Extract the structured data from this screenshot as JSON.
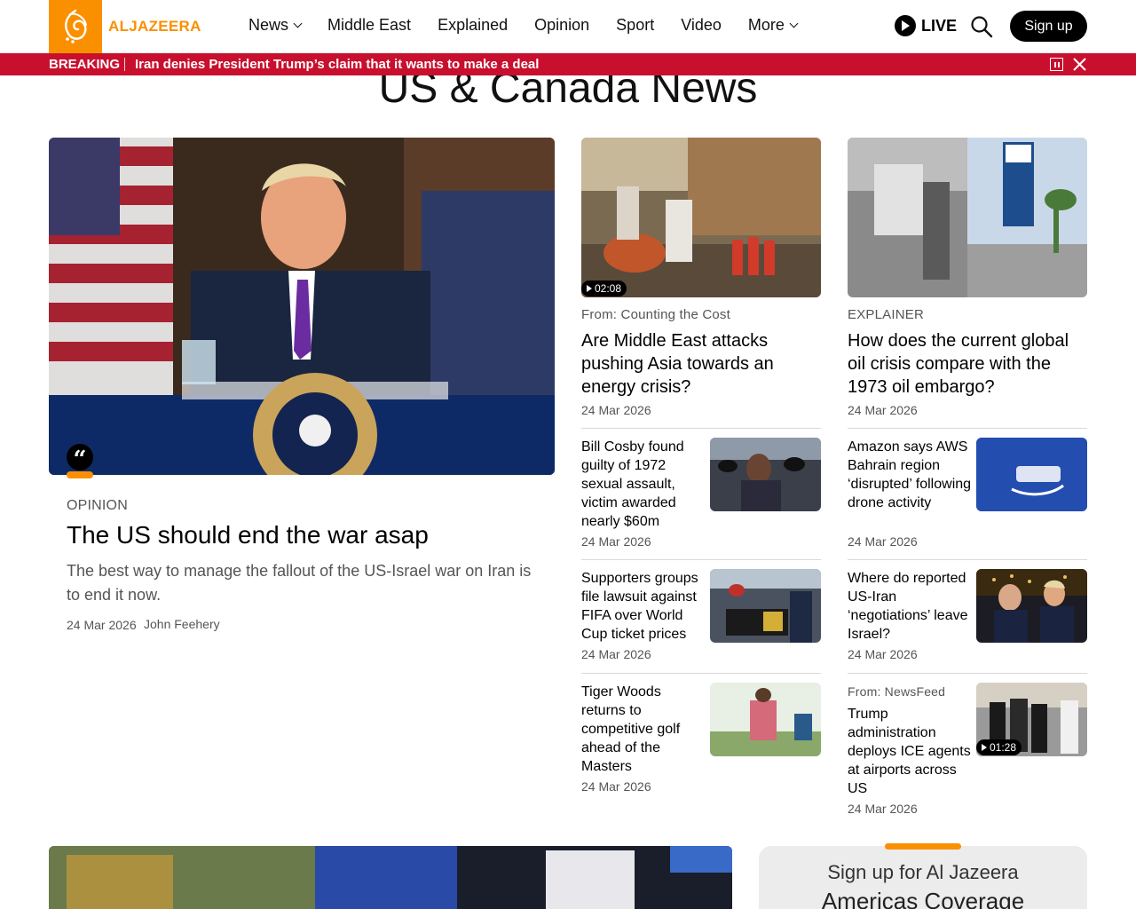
{
  "header": {
    "logo_text": "ALJAZEERA",
    "nav": [
      {
        "label": "News",
        "dropdown": true
      },
      {
        "label": "Middle East",
        "dropdown": false
      },
      {
        "label": "Explained",
        "dropdown": false
      },
      {
        "label": "Opinion",
        "dropdown": false
      },
      {
        "label": "Sport",
        "dropdown": false
      },
      {
        "label": "Video",
        "dropdown": false
      },
      {
        "label": "More",
        "dropdown": true
      }
    ],
    "live_label": "LIVE",
    "signup_label": "Sign up"
  },
  "breaking": {
    "label": "BREAKING",
    "text": "Iran denies President Trump’s claim that it wants to make a deal"
  },
  "page_title": "US & Canada News",
  "hero": {
    "kicker": "OPINION",
    "title": "The US should end the war asap",
    "subtitle": "The best way to manage the fallout of the US-Israel war on Iran is to end it now.",
    "date": "24 Mar 2026",
    "author": "John Feehery"
  },
  "feature_cards": [
    {
      "kicker": "From: Counting the Cost",
      "title": "Are Middle East attacks pushing Asia towards an energy crisis?",
      "date": "24 Mar 2026",
      "duration": "02:08"
    },
    {
      "kicker": "EXPLAINER",
      "title": "How does the current global oil crisis compare with the 1973 oil embargo?",
      "date": "24 Mar 2026"
    }
  ],
  "left_list": [
    {
      "title": "Bill Cosby found guilty of 1972 sexual assault, victim awarded nearly $60m",
      "date": "24 Mar 2026"
    },
    {
      "title": "Supporters groups file lawsuit against FIFA over World Cup ticket prices",
      "date": "24 Mar 2026"
    },
    {
      "title": "Tiger Woods returns to competitive golf ahead of the Masters",
      "date": "24 Mar 2026"
    }
  ],
  "right_list": [
    {
      "title": "Amazon says AWS Bahrain region ‘disrupted’ following drone activity",
      "date": "24 Mar 2026"
    },
    {
      "title": "Where do reported US-Iran ‘negotiations’ leave Israel?",
      "date": "24 Mar 2026"
    },
    {
      "kicker": "From: NewsFeed",
      "title": "Trump administration deploys ICE agents at airports across US",
      "date": "24 Mar 2026",
      "duration": "01:28"
    }
  ],
  "newsletter": {
    "line1": "Sign up for Al Jazeera",
    "line2": "Americas Coverage"
  },
  "colors": {
    "brand_orange": "#fa9000",
    "breaking_red": "#c8102e"
  }
}
